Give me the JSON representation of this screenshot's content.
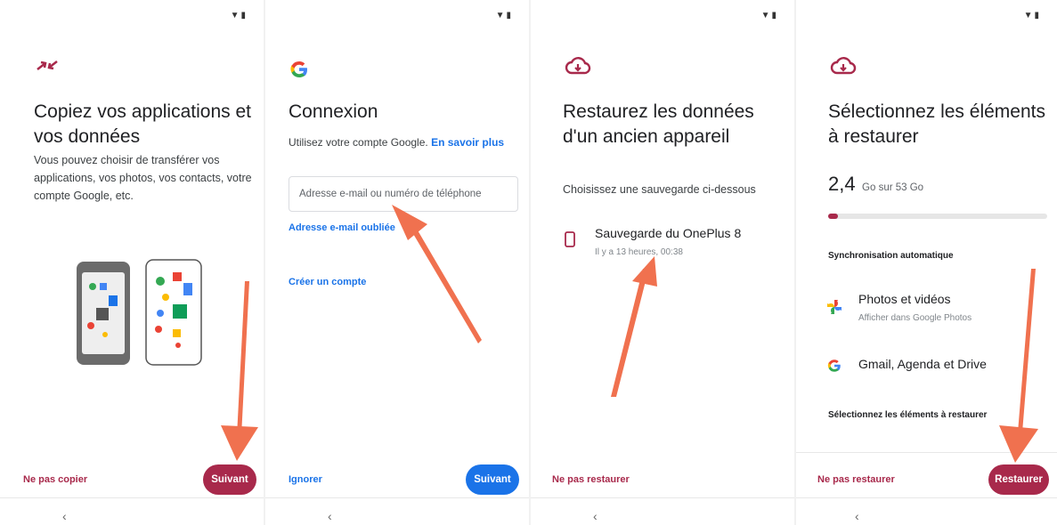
{
  "colors": {
    "accent": "#a8294b",
    "google_blue": "#1a73e8",
    "arrow": "#f0714f",
    "track": "#e6e6e6"
  },
  "status_icons": [
    "wifi-icon",
    "battery-icon"
  ],
  "panel1": {
    "title": "Copiez vos applications et vos données",
    "description": "Vous pouvez choisir de transférer vos applications, vos photos, vos contacts, votre compte Google, etc.",
    "skip_label": "Ne pas copier",
    "next_label": "Suivant"
  },
  "panel2": {
    "title": "Connexion",
    "subtitle": "Utilisez votre compte Google.",
    "learn_more": "En savoir plus",
    "input_placeholder": "Adresse e-mail ou numéro de téléphone",
    "forgot_email": "Adresse e-mail oubliée",
    "create_account": "Créer un compte",
    "skip_label": "Ignorer",
    "next_label": "Suivant"
  },
  "panel3": {
    "title": "Restaurez les données d'un ancien appareil",
    "prompt": "Choisissez une sauvegarde ci-dessous",
    "backup_name": "Sauvegarde du OnePlus 8",
    "backup_time": "Il y a 13 heures, 00:38",
    "skip_label": "Ne pas restaurer"
  },
  "panel4": {
    "title": "Sélectionnez les éléments à restaurer",
    "size_value": "2,4",
    "size_detail": "Go sur 53 Go",
    "storage_fraction": 0.045,
    "sync_heading": "Synchronisation automatique",
    "photos_title": "Photos et vidéos",
    "photos_sub": "Afficher dans Google Photos",
    "google_title": "Gmail, Agenda et Drive",
    "select_heading": "Sélectionnez les éléments à restaurer",
    "skip_label": "Ne pas restaurer",
    "restore_label": "Restaurer"
  }
}
